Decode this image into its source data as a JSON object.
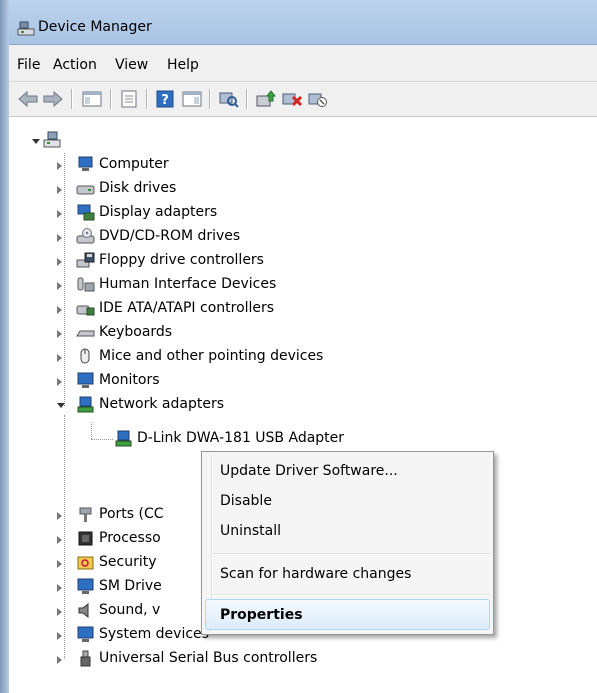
{
  "window": {
    "title": "Device Manager",
    "icon": "device-manager-icon"
  },
  "menu": [
    "File",
    "Action",
    "View",
    "Help"
  ],
  "toolbar": [
    "back-icon",
    "forward-icon",
    "show-hide-console-tree-icon",
    "properties-icon",
    "help-icon",
    "show-action-pane-icon",
    "scan-hardware-icon",
    "update-driver-icon",
    "uninstall-icon",
    "disable-icon"
  ],
  "tree": {
    "root_icon": "computer-root-icon",
    "categories": [
      {
        "label": "Computer",
        "icon": "computer-icon",
        "expanded": false
      },
      {
        "label": "Disk drives",
        "icon": "disk-drive-icon",
        "expanded": false
      },
      {
        "label": "Display adapters",
        "icon": "display-adapter-icon",
        "expanded": false
      },
      {
        "label": "DVD/CD-ROM drives",
        "icon": "dvd-drive-icon",
        "expanded": false
      },
      {
        "label": "Floppy drive controllers",
        "icon": "floppy-controller-icon",
        "expanded": false
      },
      {
        "label": "Human Interface Devices",
        "icon": "hid-icon",
        "expanded": false
      },
      {
        "label": "IDE ATA/ATAPI controllers",
        "icon": "ide-controller-icon",
        "expanded": false
      },
      {
        "label": "Keyboards",
        "icon": "keyboard-icon",
        "expanded": false
      },
      {
        "label": "Mice and other pointing devices",
        "icon": "mouse-icon",
        "expanded": false
      },
      {
        "label": "Monitors",
        "icon": "monitor-icon",
        "expanded": false
      },
      {
        "label": "Network adapters",
        "icon": "network-adapter-icon",
        "expanded": true
      }
    ],
    "child": {
      "label": "D-Link DWA-181 USB Adapter",
      "icon": "network-adapter-icon"
    },
    "lower_categories": [
      {
        "label": "Ports (CC",
        "icon": "port-icon"
      },
      {
        "label": "Processo",
        "icon": "processor-icon"
      },
      {
        "label": "Security",
        "icon": "security-icon"
      },
      {
        "label": "SM Drive",
        "icon": "sm-driver-icon"
      },
      {
        "label": "Sound, v",
        "icon": "sound-icon"
      },
      {
        "label": "System devices",
        "icon": "system-devices-icon"
      },
      {
        "label": "Universal Serial Bus controllers",
        "icon": "usb-icon"
      }
    ]
  },
  "context_menu": {
    "items": [
      {
        "label": "Update Driver Software..."
      },
      {
        "label": "Disable"
      },
      {
        "label": "Uninstall"
      },
      {
        "label": "Scan for hardware changes"
      },
      {
        "label": "Properties",
        "bold": true,
        "highlighted": true
      }
    ]
  }
}
